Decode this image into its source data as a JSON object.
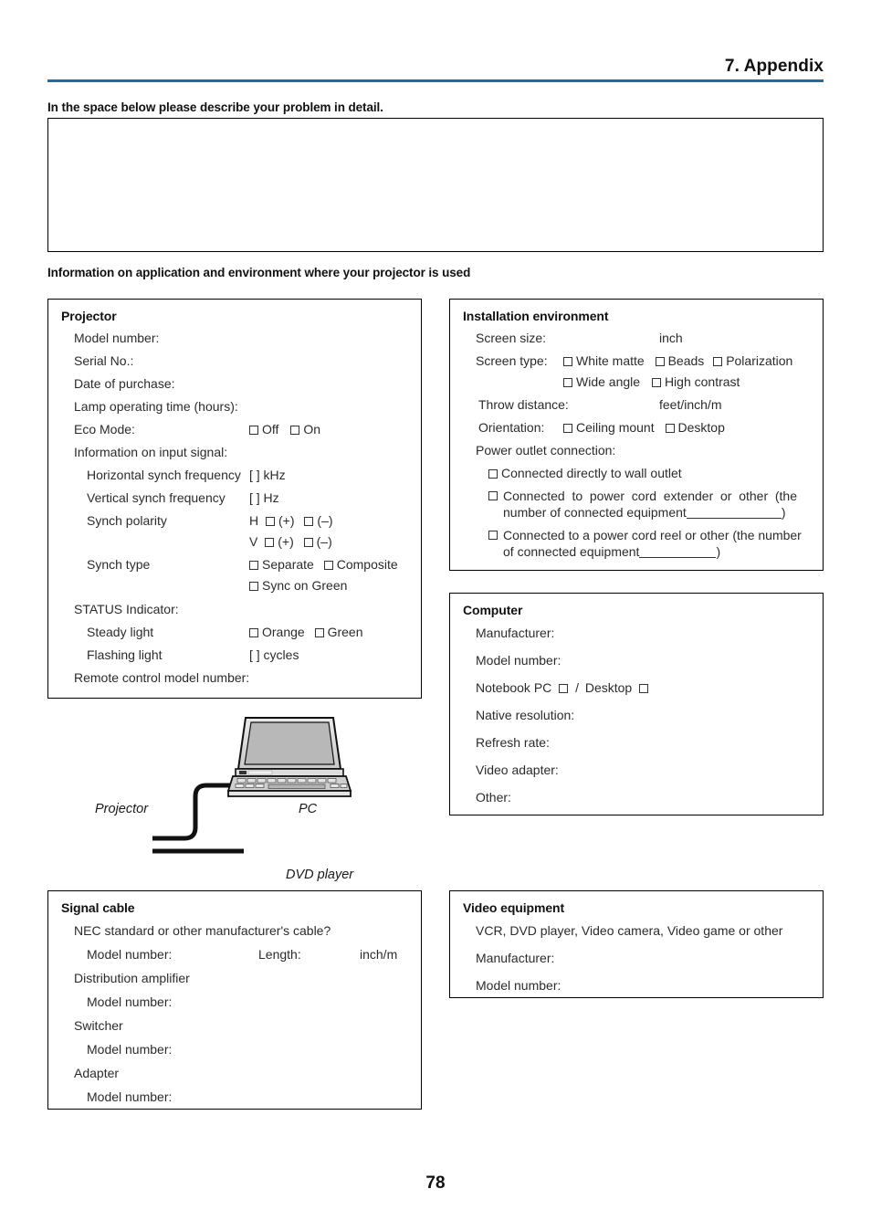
{
  "header": {
    "chapter_title": "7. Appendix",
    "rule_color": "#1a6cb0"
  },
  "problem_section": {
    "label": "In the space below please describe your problem in detail.",
    "textarea_value": ""
  },
  "info_section": {
    "label": "Information on application and environment where your projector is used"
  },
  "projector": {
    "title": "Projector",
    "model_number": "Model number:",
    "serial_no": "Serial No.:",
    "date_of_purchase": "Date of purchase:",
    "lamp_time": "Lamp operating time (hours):",
    "eco_mode": "Eco Mode:",
    "eco_off": "Off",
    "eco_on": "On",
    "input_signal": "Information on input signal:",
    "h_sync": "Horizontal synch frequency",
    "h_sync_value": "[          ] kHz",
    "v_sync": "Vertical synch frequency",
    "v_sync_value": "[          ] Hz",
    "sync_polarity": "Synch polarity",
    "pol_h": "H",
    "pol_v": "V",
    "pol_plus": "(+)",
    "pol_minus": "(–)",
    "sync_type": "Synch type",
    "sync_separate": "Separate",
    "sync_composite": "Composite",
    "sync_on_green": "Sync on Green",
    "status_indicator": "STATUS Indicator:",
    "steady_light": "Steady light",
    "steady_orange": "Orange",
    "steady_green": "Green",
    "flashing_light": "Flashing light",
    "flashing_value": "[          ] cycles",
    "remote_model": "Remote control model number:"
  },
  "installation": {
    "title": "Installation environment",
    "screen_size": "Screen size:",
    "screen_size_unit": "inch",
    "screen_type": "Screen type:",
    "type_white_matte": "White matte",
    "type_beads": "Beads",
    "type_polarization": "Polarization",
    "type_wide_angle": "Wide angle",
    "type_high_contrast": "High contrast",
    "throw_distance": "Throw distance:",
    "throw_unit": "feet/inch/m",
    "orientation": "Orientation:",
    "orient_ceiling": "Ceiling mount",
    "orient_desktop": "Desktop",
    "power_outlet": "Power outlet connection:",
    "power_wall": "Connected directly to wall outlet",
    "power_extender_line1": "Connected to power cord extender or other (the",
    "power_extender_line2": "number of connected equipment",
    "power_extender_close": ")",
    "power_reel_line1": "Connected to a power cord reel or other (the number",
    "power_reel_line2": "of connected equipment",
    "power_reel_close": ")"
  },
  "computer": {
    "title": "Computer",
    "manufacturer": "Manufacturer:",
    "model_number": "Model number:",
    "notebook_label": "Notebook PC",
    "slash": "/",
    "desktop_label": "Desktop",
    "native_resolution": "Native resolution:",
    "refresh_rate": "Refresh rate:",
    "video_adapter": "Video adapter:",
    "other": "Other:"
  },
  "signal_cable": {
    "title": "Signal cable",
    "nec_question": "NEC standard or other manufacturer's cable?",
    "model_number": "Model number:",
    "length": "Length:",
    "length_unit": "inch/m",
    "distribution_amplifier": "Distribution amplifier",
    "da_model_number": "Model number:",
    "switcher": "Switcher",
    "sw_model_number": "Model number:",
    "adapter": "Adapter",
    "ad_model_number": "Model number:"
  },
  "video_equipment": {
    "title": "Video equipment",
    "types": "VCR, DVD player, Video camera, Video game or other",
    "manufacturer": "Manufacturer:",
    "model_number": "Model number:"
  },
  "diagram": {
    "projector_caption": "Projector",
    "pc_caption": "PC",
    "dvd_caption": "DVD player"
  },
  "footer": {
    "page_number": "78"
  }
}
